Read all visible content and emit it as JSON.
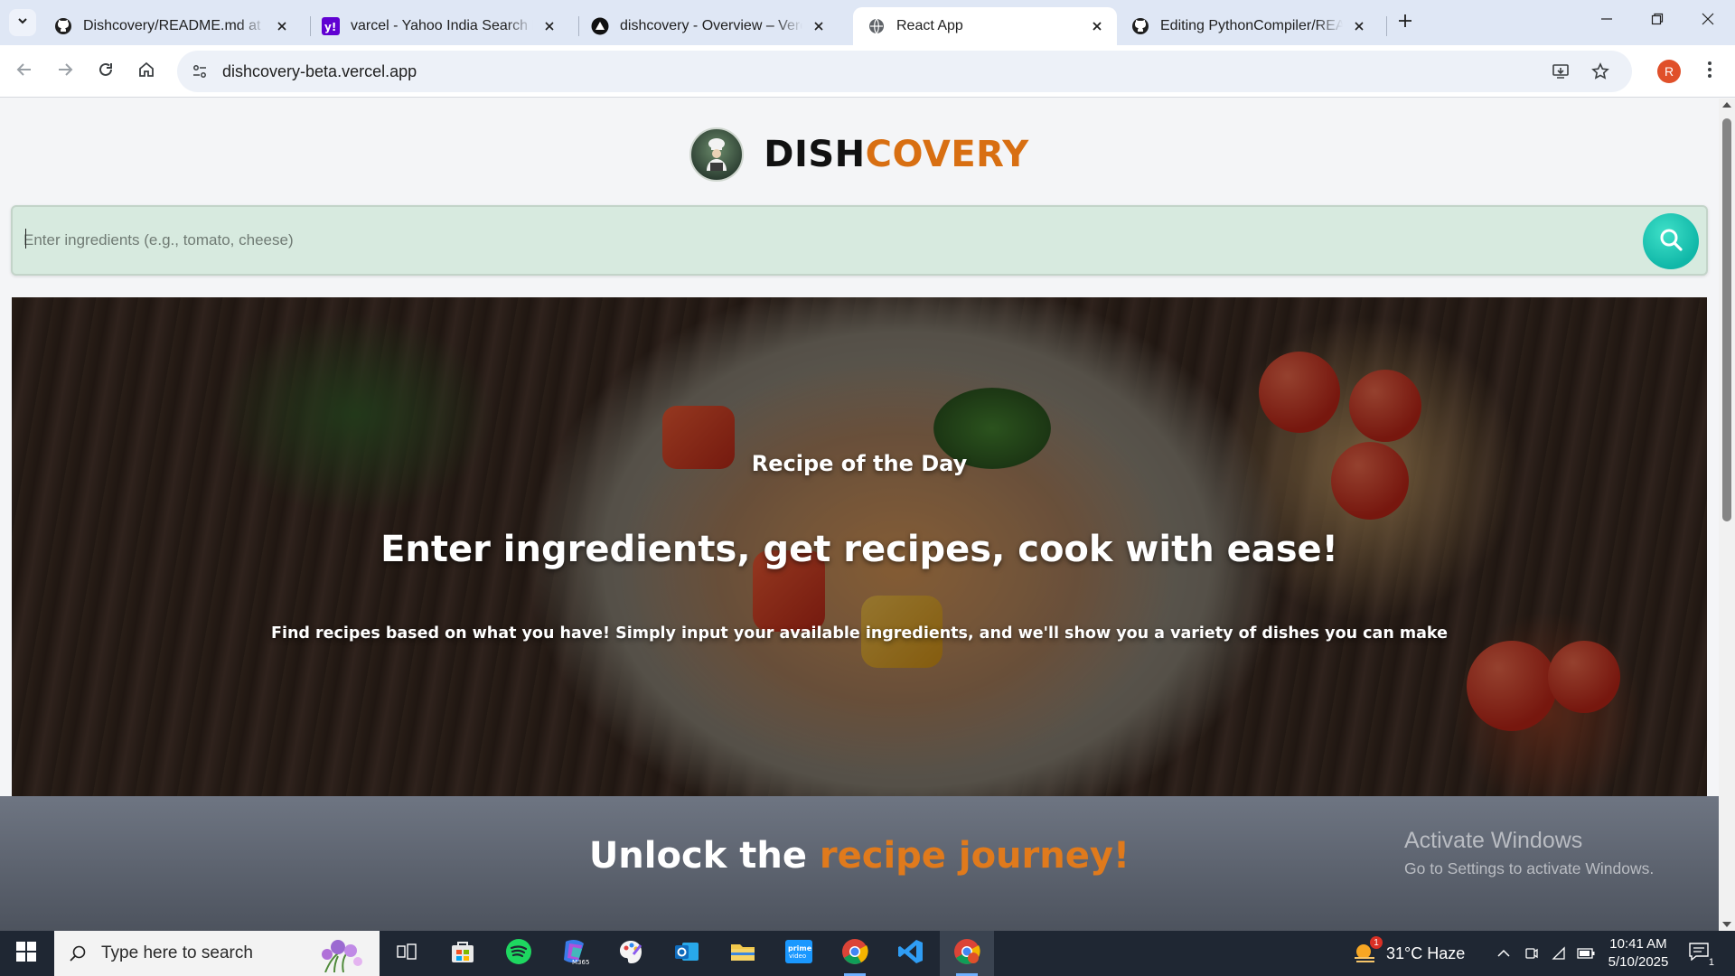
{
  "browser": {
    "tabs": [
      {
        "title": "Dishcovery/README.md at main",
        "icon": "github-icon",
        "active": false
      },
      {
        "title": "varcel - Yahoo India Search Results",
        "icon": "yahoo-icon",
        "active": false
      },
      {
        "title": "dishcovery - Overview – Vercel",
        "icon": "vercel-icon",
        "active": false
      },
      {
        "title": "React App",
        "icon": "globe-icon",
        "active": true
      },
      {
        "title": "Editing PythonCompiler/README.md",
        "icon": "github-icon",
        "active": false
      }
    ],
    "url": "dishcovery-beta.vercel.app",
    "profile_initial": "R"
  },
  "page": {
    "brand_part1": "DISH",
    "brand_part2": "COVERY",
    "search_placeholder": "Enter ingredients (e.g., tomato, cheese)",
    "hero": {
      "subtitle": "Recipe of the Day",
      "title": "Enter ingredients, get recipes, cook with ease!",
      "description": "Find recipes based on what you have! Simply input your available ingredients, and we'll show you a variety of dishes you can make"
    },
    "unlock_part1": "Unlock the",
    "unlock_part2": "recipe journey!",
    "watermark": {
      "line1": "Activate Windows",
      "line2": "Go to Settings to activate Windows."
    }
  },
  "taskbar": {
    "search_placeholder": "Type here to search",
    "weather": "31°C  Haze",
    "weather_badge": "1",
    "time": "10:41 AM",
    "date": "5/10/2025",
    "notification_count": "1",
    "apps": [
      "task-view",
      "microsoft-store",
      "spotify",
      "microsoft-365",
      "paint",
      "outlook",
      "file-explorer",
      "prime-video",
      "chrome",
      "vs-code",
      "chrome-profile"
    ]
  },
  "colors": {
    "brand_accent": "#d86f12",
    "search_bg": "#d7eadf",
    "search_button": "#10b7a8",
    "unlock_accent": "#e07a1c"
  }
}
